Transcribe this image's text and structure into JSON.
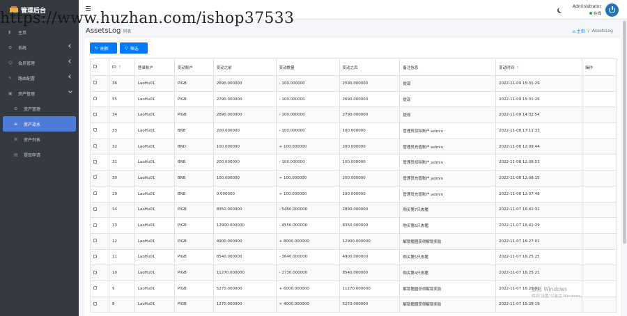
{
  "brand": {
    "title": "管理后台"
  },
  "watermark": "https://www.huzhan.com/ishop37533",
  "sidebar": {
    "items": [
      {
        "icon": "dashboard-icon",
        "glyph": "▮",
        "label": "主页",
        "has_chevron": false
      },
      {
        "icon": "gear-icon",
        "glyph": "⚙",
        "label": "系统",
        "has_chevron": true
      },
      {
        "icon": "users-icon",
        "glyph": "☺",
        "label": "会员管理",
        "has_chevron": true
      },
      {
        "icon": "cash-icon",
        "glyph": "✎",
        "label": "路由配置",
        "has_chevron": true
      },
      {
        "icon": "assets-icon",
        "glyph": "▣",
        "label": "资产管理",
        "has_chevron": true,
        "expanded": true
      }
    ],
    "sub_items": [
      {
        "icon": "settings-icon",
        "glyph": "⚙",
        "label": "资产管理",
        "active": false
      },
      {
        "icon": "log-icon",
        "glyph": "≡",
        "label": "资产流水",
        "active": true
      },
      {
        "icon": "list-icon",
        "glyph": "≣",
        "label": "资产列表",
        "active": false
      },
      {
        "icon": "withdraw-icon",
        "glyph": "▤",
        "label": "提现申请",
        "active": false
      }
    ]
  },
  "topbar": {
    "user_name": "Administrator",
    "user_status": "在线"
  },
  "page": {
    "title": "AssetsLog",
    "subtitle": "列表",
    "breadcrumb_home": "主页",
    "breadcrumb_current": "AssetsLog"
  },
  "toolbar": {
    "refresh_label": "刷新",
    "filter_label": "筛选"
  },
  "table": {
    "columns": [
      "",
      "ID",
      "登录账户",
      "变动账户",
      "变动之前",
      "变动数量",
      "变动之后",
      "备注信息",
      "变动时间",
      "操作"
    ],
    "rows": [
      [
        "36",
        "LaoHu01",
        "PIGB",
        "2690.000000",
        "- 100.000000",
        "2590.000000",
        "提现",
        "2022-11-09 15:31:29"
      ],
      [
        "35",
        "LaoHu01",
        "PIGB",
        "2790.000000",
        "- 100.000000",
        "2690.000000",
        "提现",
        "2022-11-09 15:31:26"
      ],
      [
        "34",
        "LaoHu01",
        "PIGB",
        "2890.000000",
        "- 100.000000",
        "2790.000000",
        "提现",
        "2022-11-09 14:32:54"
      ],
      [
        "33",
        "LaoHu01",
        "BNB",
        "200.000000",
        "- 100.000000",
        "100.000000",
        "管理员扣除账户:admin",
        "2022-11-08 17:11:33"
      ],
      [
        "32",
        "LaoHu01",
        "BND",
        "100.000000",
        "+ 100.000000",
        "200.000000",
        "管理员充值账户:admin",
        "2022-11-08 12:09:44"
      ],
      [
        "31",
        "LaoHu01",
        "BNB",
        "200.000000",
        "- 100.000000",
        "100.000000",
        "管理员扣除账户:admin",
        "2022-11-08 12:08:53"
      ],
      [
        "30",
        "LaoHu01",
        "BNB",
        "100.000000",
        "+ 100.000000",
        "200.000000",
        "管理员充值账户:admin",
        "2022-11-08 12:08:15"
      ],
      [
        "29",
        "LaoHu01",
        "BNB",
        "0.000000",
        "+ 100.000000",
        "100.000000",
        "管理员充值账户:admin",
        "2022-11-08 12:07:48"
      ],
      [
        "14",
        "LaoHu01",
        "PIGB",
        "8350.000000",
        "- 5460.000000",
        "2890.000000",
        "购买第7只肉猪",
        "2022-11-07 16:41:31"
      ],
      [
        "13",
        "LaoHu01",
        "PIGB",
        "12900.000000",
        "- 4550.000000",
        "8350.000000",
        "购买第5只肉猪",
        "2022-11-07 16:41:29"
      ],
      [
        "12",
        "LaoHu01",
        "PIGB",
        "4900.000000",
        "+ 8000.000000",
        "12900.000000",
        "解锁猪圈获得解锁奖励",
        "2022-11-07 16:27:01"
      ],
      [
        "11",
        "LaoHu01",
        "PIGB",
        "8540.000000",
        "- 3640.000000",
        "4900.000000",
        "购买第5只肉猪",
        "2022-11-07 16:25:25"
      ],
      [
        "10",
        "LaoHu01",
        "PIGB",
        "11270.000000",
        "- 2730.000000",
        "8540.000000",
        "购买第4只肉猪",
        "2022-11-07 16:25:21"
      ],
      [
        "9",
        "LaoHu01",
        "PIGB",
        "5270.000000",
        "+ 6000.000000",
        "11270.000000",
        "解锁猪圈获得解锁奖励",
        "2022-11-07 16:25:01"
      ],
      [
        "8",
        "LaoHu01",
        "PIGB",
        "1270.000000",
        "+ 4000.000000",
        "5270.000000",
        "解锁猪圈获得解锁奖励",
        "2022-11-07 15:28:19"
      ]
    ]
  },
  "activation": {
    "line1": "激活 Windows",
    "line2": "转到\"设置\"以激活 Windows。"
  }
}
